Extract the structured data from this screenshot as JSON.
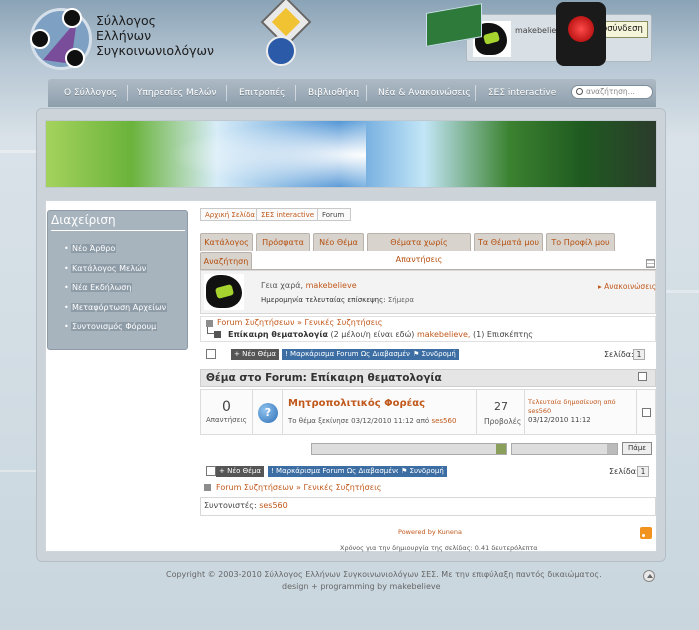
{
  "header": {
    "logo_lines": [
      "Σύλλογος",
      "Ελλήνων",
      "Συγκοινωνιολόγων"
    ],
    "username": "makebelieve design",
    "logout_label": "Αποσύνδεση"
  },
  "nav": {
    "items": [
      "Ο Σύλλογος",
      "Υπηρεσίες Μελών",
      "Επιτροπές",
      "Βιβλιοθήκη",
      "Νέα & Ανακοινώσεις",
      "ΣΕΣ interactive"
    ],
    "search_placeholder": "αναζήτηση..."
  },
  "sidebar": {
    "title": "Διαχείριση",
    "items": [
      "Νέο Άρθρο",
      "Κατάλογος Μελών",
      "Νέα Εκδήλωση",
      "Μεταφόρτωση Αρχείων",
      "Συντονισμός Φόρουμ"
    ]
  },
  "breadcrumb": [
    "Αρχική Σελίδα",
    "ΣΕΣ interactive",
    "Forum"
  ],
  "tabs": [
    "Κατάλογος",
    "Πρόσφατα",
    "Νέο Θέμα",
    "Θέματα χωρίς Απαντήσεις",
    "Τα Θέματά μου",
    "Το Προφίλ μου",
    "Αναζήτηση"
  ],
  "welcome": {
    "greeting": "Γεια χαρά,",
    "user": "makebelieve",
    "last_visit_label": "Ημερομηνία τελευταίας επίσκεψης:",
    "last_visit_value": "Σήμερα",
    "announcements": "Ανακοινώσεις"
  },
  "path": {
    "top": "Forum Συζητήσεων » Γενικές Συζητήσεις",
    "category": "Επίκαιρη θεματολογία",
    "viewers": "(2 μέλοι/η είναι εδώ)",
    "viewer_user": "makebelieve,",
    "guests": "(1) Επισκέπτης"
  },
  "toolbar": {
    "new_topic": "Νέο Θέμα",
    "mark_read": "Μαρκάρισμα Forum Ως Διαβασμένο",
    "subscribe": "Συνδρομή",
    "pages_label": "Σελίδα:",
    "page": "1"
  },
  "topics": {
    "header": "Θέμα στο Forum: Επίκαιρη θεματολογία",
    "rows": [
      {
        "replies": "0",
        "replies_label": "Απαντήσεις",
        "title": "Μητροπολιτικός Φορέας",
        "meta_text": "Το θέμα ξεκίνησε 03/12/2010 11:12 από",
        "author": "ses560",
        "views": "27",
        "views_label": "Προβολές",
        "last_label": "Τελευταία δημοσίευση από",
        "last_user": "ses560",
        "last_date": "03/12/2010 11:12"
      }
    ],
    "go_label": "Πάμε"
  },
  "online": {
    "label": "Συντονιστές:",
    "user": "ses560"
  },
  "footer": {
    "powered": "Powered by Kunena",
    "gen_time": "Χρόνος για την δημιουργία της σελίδας: 0.41 δευτερόλεπτα",
    "copyright": "Copyright © 2003-2010 Σύλλογος Ελλήνων Συγκοινωνιολόγων ΣΕΣ. Με την επιφύλαξη παντός δικαιώματος.",
    "credits": "design + programming by makebelieve"
  }
}
